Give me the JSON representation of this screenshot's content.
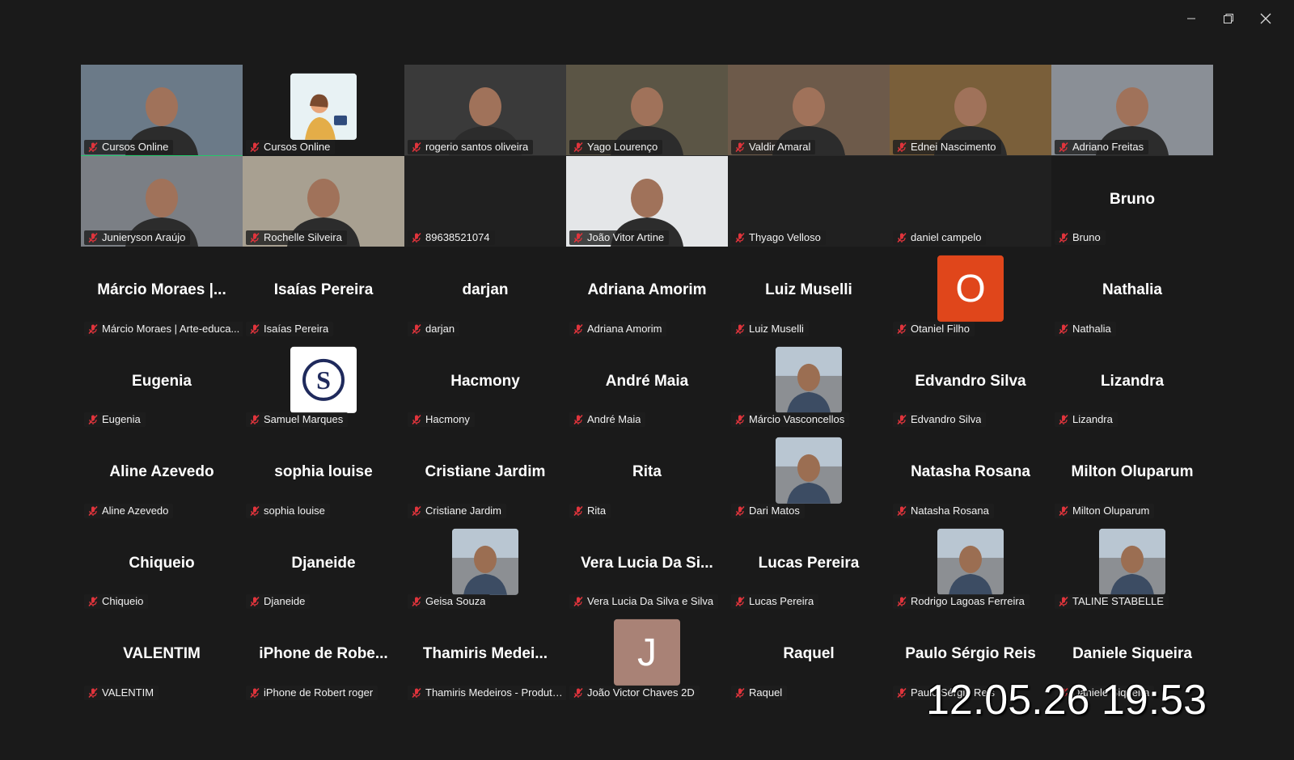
{
  "window_controls": {
    "minimize_icon": "minimize-icon",
    "restore_icon": "restore-icon",
    "close_icon": "close-icon"
  },
  "colors": {
    "background": "#1a1a1a",
    "active_speaker": "#24c96b",
    "mute": "#e0343c",
    "avatar_O": "#e0461b",
    "avatar_J": "#a98276"
  },
  "participants": [
    {
      "label": "Cursos Online",
      "kind": "video",
      "active": true
    },
    {
      "label": "Cursos Online",
      "kind": "avatar-illustration"
    },
    {
      "label": "rogerio santos oliveira",
      "kind": "video"
    },
    {
      "label": "Yago Lourenço",
      "kind": "video"
    },
    {
      "label": "Valdir Amaral",
      "kind": "video"
    },
    {
      "label": "Ednei Nascimento",
      "kind": "video"
    },
    {
      "label": "Adriano Freitas",
      "kind": "video"
    },
    {
      "label": "Junieryson Araújo",
      "kind": "video"
    },
    {
      "label": "Rochelle Silveira",
      "kind": "video"
    },
    {
      "label": "89638521074",
      "kind": "dark"
    },
    {
      "label": "João Vitor Artine",
      "kind": "video"
    },
    {
      "label": "Thyago Velloso",
      "kind": "dark"
    },
    {
      "label": "daniel campelo",
      "kind": "dark"
    },
    {
      "label": "Bruno",
      "kind": "name",
      "display": "Bruno"
    },
    {
      "label": "Márcio Moraes | Arte-educa...",
      "kind": "name",
      "display": "Márcio Moraes |..."
    },
    {
      "label": "Isaías Pereira",
      "kind": "name",
      "display": "Isaías Pereira"
    },
    {
      "label": "darjan",
      "kind": "name",
      "display": "darjan"
    },
    {
      "label": "Adriana Amorim",
      "kind": "name",
      "display": "Adriana Amorim"
    },
    {
      "label": "Luiz Muselli",
      "kind": "name",
      "display": "Luiz Muselli"
    },
    {
      "label": "Otaniel Filho",
      "kind": "letter",
      "letter": "O",
      "color": "#e0461b"
    },
    {
      "label": "Nathalia",
      "kind": "name",
      "display": "Nathalia"
    },
    {
      "label": "Eugenia",
      "kind": "name",
      "display": "Eugenia"
    },
    {
      "label": "Samuel Marques",
      "kind": "logo-s"
    },
    {
      "label": "Hacmony",
      "kind": "name",
      "display": "Hacmony"
    },
    {
      "label": "André Maia",
      "kind": "name",
      "display": "André Maia"
    },
    {
      "label": "Márcio Vasconcellos",
      "kind": "avatar-photo"
    },
    {
      "label": "Edvandro Silva",
      "kind": "name",
      "display": "Edvandro Silva"
    },
    {
      "label": "Lizandra",
      "kind": "name",
      "display": "Lizandra"
    },
    {
      "label": "Aline Azevedo",
      "kind": "name",
      "display": "Aline Azevedo"
    },
    {
      "label": "sophia louise",
      "kind": "name",
      "display": "sophia louise"
    },
    {
      "label": "Cristiane Jardim",
      "kind": "name",
      "display": "Cristiane Jardim"
    },
    {
      "label": "Rita",
      "kind": "name",
      "display": "Rita"
    },
    {
      "label": "Dari Matos",
      "kind": "avatar-photo"
    },
    {
      "label": "Natasha Rosana",
      "kind": "name",
      "display": "Natasha Rosana"
    },
    {
      "label": "Milton Oluparum",
      "kind": "name",
      "display": "Milton Oluparum"
    },
    {
      "label": "Chiqueio",
      "kind": "name",
      "display": "Chiqueio"
    },
    {
      "label": "Djaneide",
      "kind": "name",
      "display": "Djaneide"
    },
    {
      "label": "Geisa Souza",
      "kind": "avatar-photo"
    },
    {
      "label": "Vera Lucia Da Silva e Silva",
      "kind": "name",
      "display": "Vera Lucia Da Si..."
    },
    {
      "label": "Lucas Pereira",
      "kind": "name",
      "display": "Lucas Pereira"
    },
    {
      "label": "Rodrigo Lagoas Ferreira",
      "kind": "avatar-photo"
    },
    {
      "label": "TALINE STABELLE",
      "kind": "avatar-photo"
    },
    {
      "label": "VALENTIM",
      "kind": "name",
      "display": "VALENTIM"
    },
    {
      "label": "iPhone de Robert roger",
      "kind": "name",
      "display": "iPhone de Robe..."
    },
    {
      "label": "Thamiris Medeiros - Produto...",
      "kind": "name",
      "display": "Thamiris Medei..."
    },
    {
      "label": "João Victor Chaves 2D",
      "kind": "letter",
      "letter": "J",
      "color": "#a98276"
    },
    {
      "label": "Raquel",
      "kind": "name",
      "display": "Raquel"
    },
    {
      "label": "Paulo Sérgio Reis",
      "kind": "name",
      "display": "Paulo Sérgio Reis"
    },
    {
      "label": "Daniele Siqueira",
      "kind": "name",
      "display": "Daniele Siqueira"
    }
  ],
  "timestamp": "12.05.26 19:53"
}
